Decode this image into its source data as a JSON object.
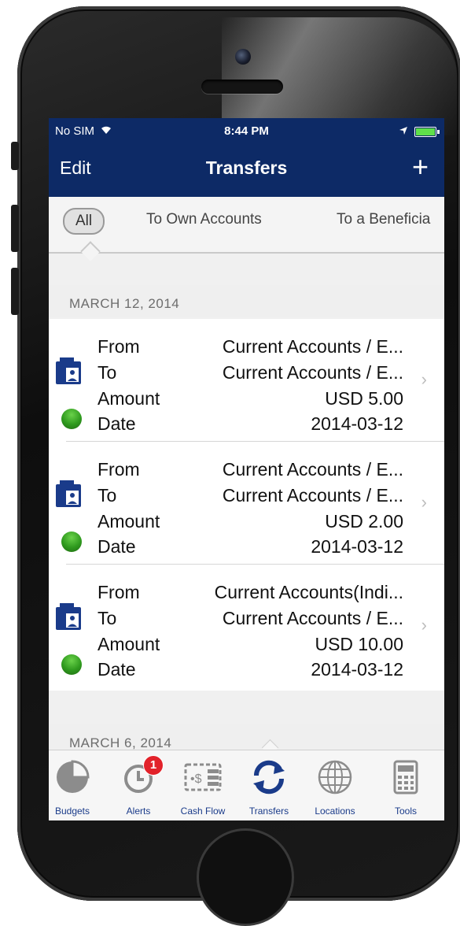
{
  "status_bar": {
    "carrier": "No SIM",
    "time": "8:44 PM"
  },
  "navbar": {
    "edit_label": "Edit",
    "title": "Transfers",
    "add_label": "+"
  },
  "filter_tabs": [
    "All",
    "To Own Accounts",
    "To a Beneficia"
  ],
  "sections": [
    {
      "date": "MARCH 12, 2014"
    },
    {
      "date": "MARCH 6, 2014"
    }
  ],
  "row_labels": {
    "from": "From",
    "to": "To",
    "amount": "Amount",
    "date": "Date"
  },
  "transfers": [
    {
      "from": "Current Accounts / E...",
      "to": "Current Accounts / E...",
      "amount": "USD 5.00",
      "date": "2014-03-12",
      "status_color": "#2f9a1e"
    },
    {
      "from": "Current Accounts / E...",
      "to": "Current Accounts / E...",
      "amount": "USD 2.00",
      "date": "2014-03-12",
      "status_color": "#2f9a1e"
    },
    {
      "from": "Current Accounts(Indi...",
      "to": "Current Accounts / E...",
      "amount": "USD 10.00",
      "date": "2014-03-12",
      "status_color": "#2f9a1e"
    }
  ],
  "tab_bar": {
    "items": [
      {
        "label": "Budgets",
        "icon": "pie-chart-icon"
      },
      {
        "label": "Alerts",
        "icon": "alarm-icon",
        "badge": "1"
      },
      {
        "label": "Cash Flow",
        "icon": "cash-flow-icon"
      },
      {
        "label": "Transfers",
        "icon": "transfer-arrows-icon"
      },
      {
        "label": "Locations",
        "icon": "globe-icon"
      },
      {
        "label": "Tools",
        "icon": "calculator-icon"
      }
    ]
  },
  "colors": {
    "navbar": "#0d2a66",
    "accent": "#1a3b8a",
    "badge": "#e2222a",
    "status_ok": "#2f9a1e"
  }
}
